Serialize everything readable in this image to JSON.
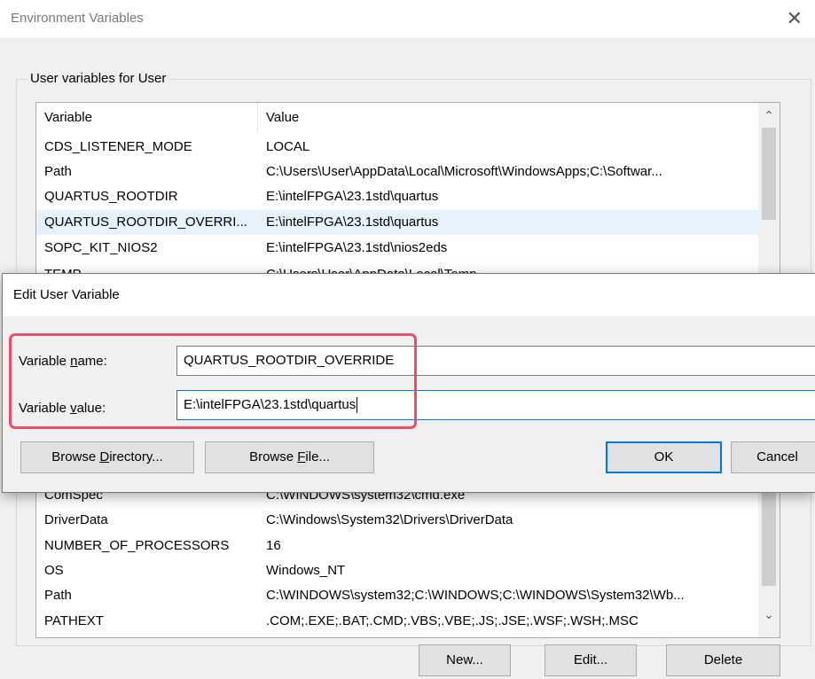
{
  "window": {
    "title": "Environment Variables",
    "close_glyph": "✕",
    "user_group_label": "User variables for User"
  },
  "user_vars": {
    "headers": {
      "variable": "Variable",
      "value": "Value"
    },
    "rows": [
      {
        "name": "CDS_LISTENER_MODE",
        "value": "LOCAL"
      },
      {
        "name": "Path",
        "value": "C:\\Users\\User\\AppData\\Local\\Microsoft\\WindowsApps;C:\\Softwar..."
      },
      {
        "name": "QUARTUS_ROOTDIR",
        "value": "E:\\intelFPGA\\23.1std\\quartus"
      },
      {
        "name": "QUARTUS_ROOTDIR_OVERRI...",
        "value": "E:\\intelFPGA\\23.1std\\quartus"
      },
      {
        "name": "SOPC_KIT_NIOS2",
        "value": "E:\\intelFPGA\\23.1std\\nios2eds"
      },
      {
        "name": "TEMP",
        "value": "C:\\Users\\User\\AppData\\Local\\Temp"
      }
    ],
    "scroll_up_glyph": "⌃"
  },
  "system_vars": {
    "rows": [
      {
        "name": "ComSpec",
        "value": "C:\\WINDOWS\\system32\\cmd.exe"
      },
      {
        "name": "DriverData",
        "value": "C:\\Windows\\System32\\Drivers\\DriverData"
      },
      {
        "name": "NUMBER_OF_PROCESSORS",
        "value": "16"
      },
      {
        "name": "OS",
        "value": "Windows_NT"
      },
      {
        "name": "Path",
        "value": "C:\\WINDOWS\\system32;C:\\WINDOWS;C:\\WINDOWS\\System32\\Wb..."
      },
      {
        "name": "PATHEXT",
        "value": ".COM;.EXE;.BAT;.CMD;.VBS;.VBE;.JS;.JSE;.WSF;.WSH;.MSC"
      }
    ],
    "scroll_down_glyph": "⌄",
    "buttons": {
      "new": "New...",
      "edit": "Edit...",
      "delete": "Delete"
    }
  },
  "edit_dialog": {
    "title": "Edit User Variable",
    "name_label_pre": "Variable ",
    "name_label_key": "n",
    "name_label_post": "ame:",
    "name_value": "QUARTUS_ROOTDIR_OVERRIDE",
    "value_label_pre": "Variable ",
    "value_label_key": "v",
    "value_label_post": "alue:",
    "value_value": "E:\\intelFPGA\\23.1std\\quartus",
    "browse_dir_pre": "Browse ",
    "browse_dir_key": "D",
    "browse_dir_post": "irectory...",
    "browse_file_pre": "Browse ",
    "browse_file_key": "F",
    "browse_file_post": "ile...",
    "ok": "OK",
    "cancel": "Cancel"
  },
  "colors": {
    "highlight_border": "#e8506a",
    "focus_blue": "#0078d7",
    "selection": "#e5f1fb"
  }
}
